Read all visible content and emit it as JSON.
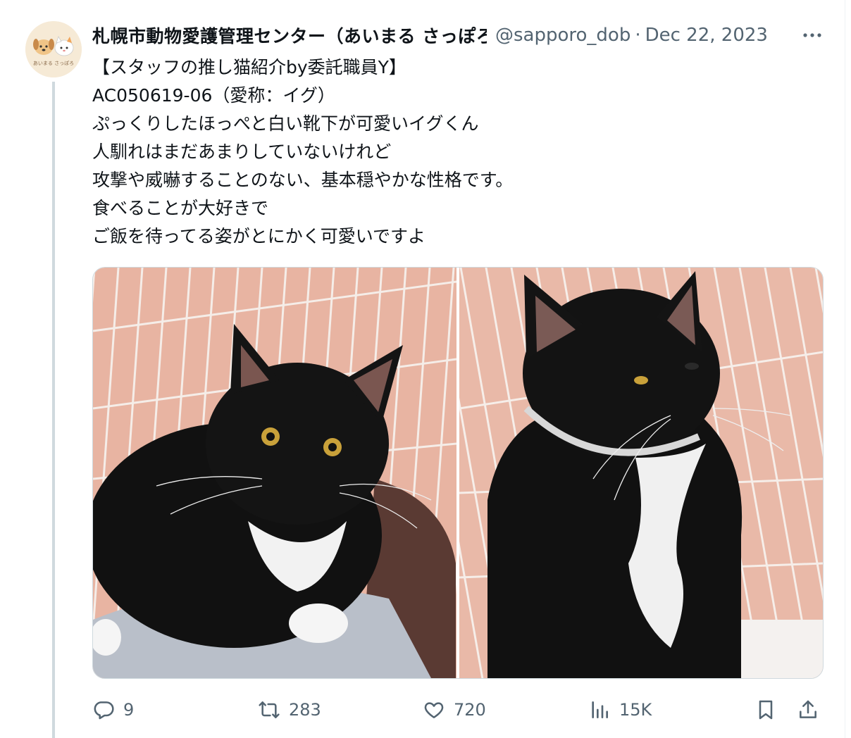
{
  "tweet": {
    "author_name": "札幌市動物愛護管理センター（あいまる さっぽろ）",
    "handle": "@sapporo_dob",
    "separator": "·",
    "date": "Dec 22, 2023",
    "avatar_text": "あいまる さっぽろ",
    "lines": [
      "【スタッフの推し猫紹介by委託職員Y】",
      "AC050619-06（愛称：イグ）",
      "ぷっくりしたほっぺと白い靴下が可愛いイグくん",
      "人馴れはまだあまりしていないけれど",
      "攻撃や威嚇することのない、基本穏やかな性格です。",
      "食べることが大好きで",
      "ご飯を待ってる姿がとにかく可愛いですよ"
    ]
  },
  "actions": {
    "replies": "9",
    "reposts": "283",
    "likes": "720",
    "views": "15K"
  },
  "colors": {
    "secondary_text": "#536471",
    "thread_line": "#cfd9de",
    "pink_wall": "#e9b7a6"
  },
  "icons": [
    "more-icon",
    "reply-icon",
    "retweet-icon",
    "like-icon",
    "views-icon",
    "bookmark-icon",
    "share-icon"
  ]
}
